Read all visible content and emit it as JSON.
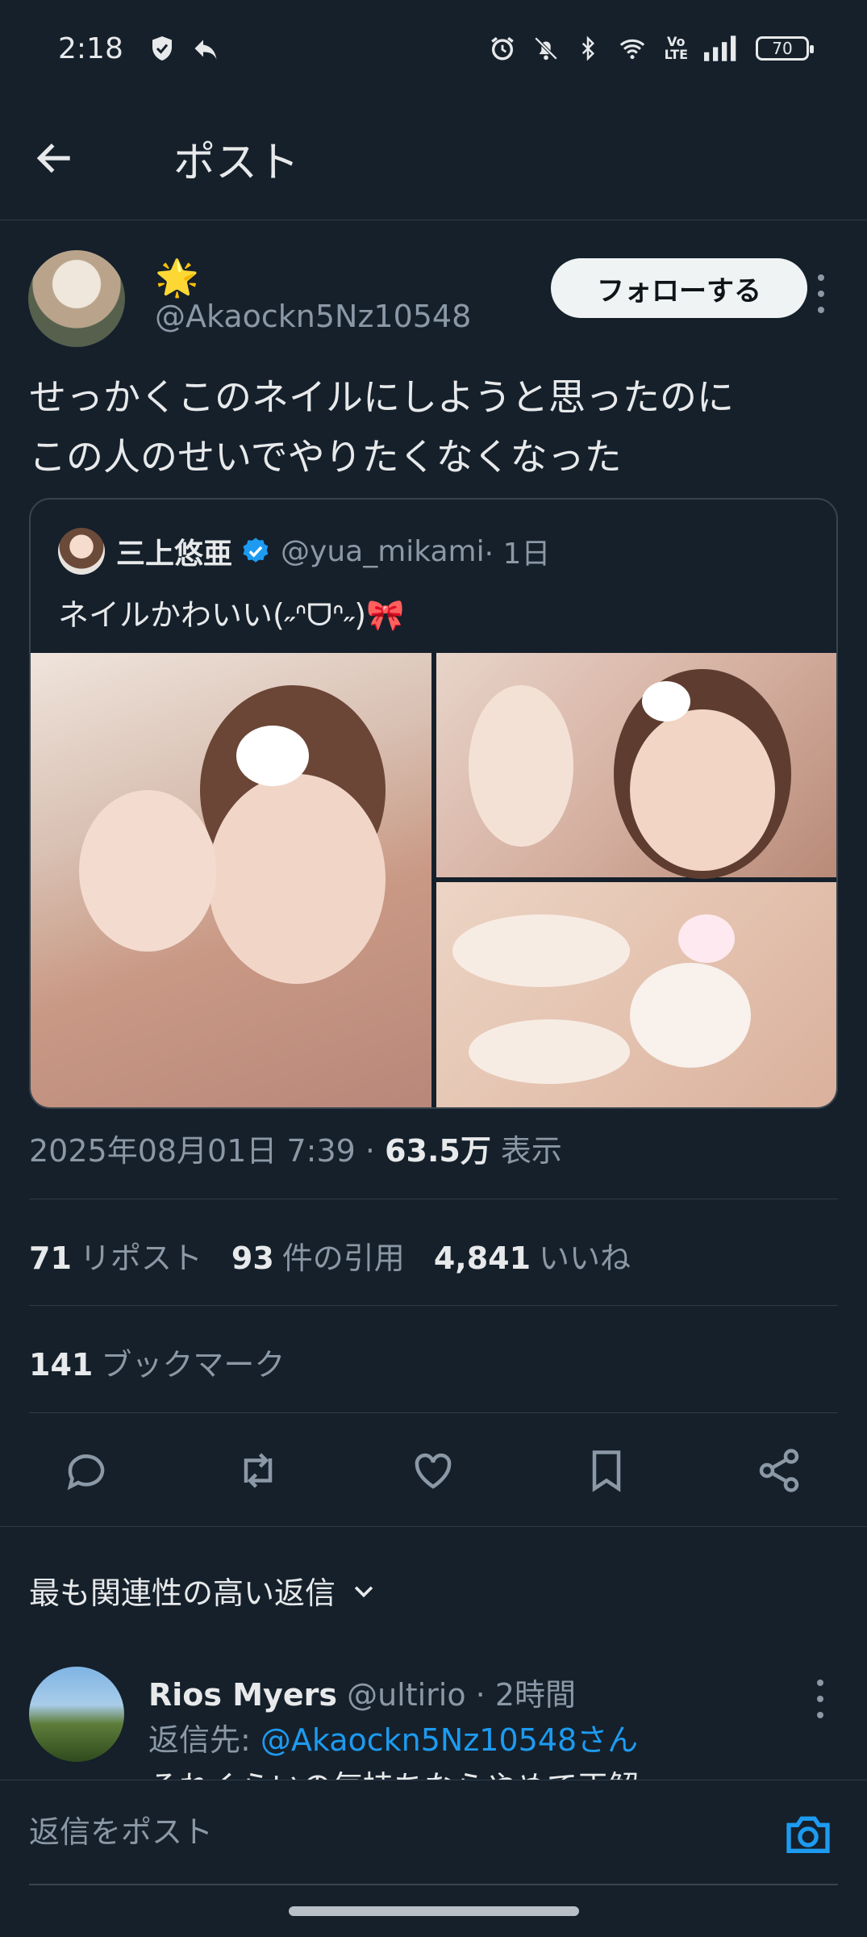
{
  "status": {
    "time": "2:18",
    "battery": "70",
    "volte_top": "Vo",
    "volte_bottom": "LTE",
    "icons_left": [
      "shield-check-icon",
      "reply-arrow-icon"
    ],
    "icons_right": [
      "alarm-icon",
      "bell-off-icon",
      "bluetooth-icon",
      "wifi-icon",
      "volte-icon",
      "signal-icon",
      "battery-icon"
    ]
  },
  "top_bar": {
    "title": "ポスト",
    "back_icon": "arrow-left-icon"
  },
  "post": {
    "display_name": "🌟",
    "handle": "@Akaockn5Nz10548",
    "follow_label": "フォローする",
    "text_lines": [
      "せっかくこのネイルにしようと思ったのに",
      "この人のせいでやりたくなくなった"
    ],
    "timestamp": "2025年08月01日 7:39 · ",
    "views_count": "63.5万",
    "views_label": " 表示",
    "stats": {
      "reposts_count": "71",
      "reposts_label": "リポスト",
      "quotes_count": "93",
      "quotes_label": "件の引用",
      "likes_count": "4,841",
      "likes_label": "いいね",
      "bookmarks_count": "141",
      "bookmarks_label": "ブックマーク"
    }
  },
  "quote": {
    "name": "三上悠亜",
    "handle": "@yua_mikami",
    "time": " · 1日",
    "text": "ネイルかわいい(˶ᐢᗜᐢ˶)🎀"
  },
  "actions": [
    "reply-icon",
    "repost-icon",
    "like-icon",
    "bookmark-icon",
    "share-icon"
  ],
  "replies_sort": {
    "label": "最も関連性の高い返信"
  },
  "reply": {
    "name": "Rios Myers",
    "handle": "@ultirio",
    "time": " · 2時間",
    "reply_to_prefix": "返信先: ",
    "reply_to_mention": "@Akaockn5Nz10548さん",
    "body": "それくらいの気持ちならやめて正解"
  },
  "composer": {
    "placeholder": "返信をポスト"
  },
  "colors": {
    "background": "#15202b",
    "accent": "#1d9bf0",
    "text_primary": "#e7e9ea",
    "text_secondary": "#8b98a5"
  }
}
